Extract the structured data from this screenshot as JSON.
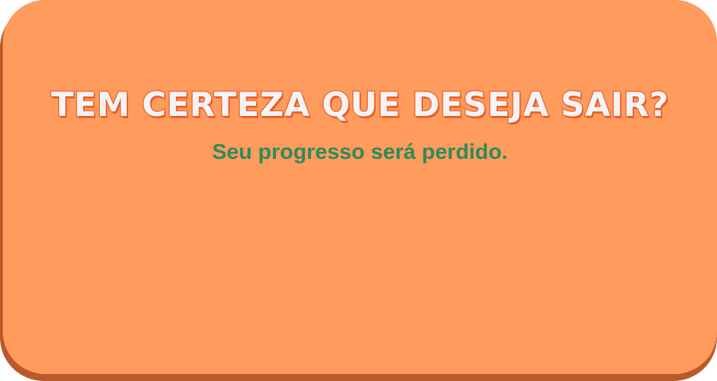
{
  "dialog": {
    "title": "TEM CERTEZA QUE DESEJA SAIR?",
    "message": "Seu progresso será perdido."
  },
  "colors": {
    "panel": "#ff9b5c",
    "panel_shadow": "#b85a2a",
    "title_fill": "#f5f3f6",
    "title_outline": "#ea5d24",
    "message": "#2f8b5a"
  }
}
